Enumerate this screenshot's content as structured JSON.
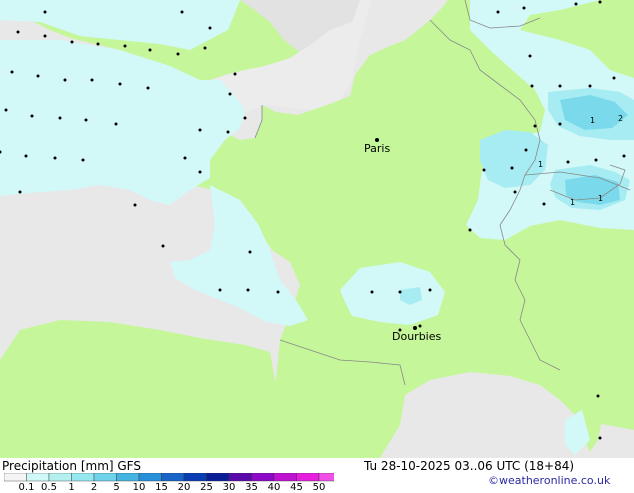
{
  "map": {
    "cities": [
      {
        "name": "Paris"
      },
      {
        "name": "Dourbies"
      }
    ],
    "precip_values": [
      {
        "label": "1"
      },
      {
        "label": "2"
      },
      {
        "label": "1"
      },
      {
        "label": "1"
      },
      {
        "label": "1"
      }
    ]
  },
  "footer": {
    "title": "Precipitation [mm]  GFS",
    "datetime": "Tu 28-10-2025 03..06 UTC (18+84)",
    "copyright": "©weatheronline.co.uk"
  },
  "legend": {
    "ticks": [
      "0.1",
      "0.5",
      "1",
      "2",
      "5",
      "10",
      "15",
      "20",
      "25",
      "30",
      "35",
      "40",
      "45",
      "50"
    ],
    "colors": [
      "#f5f5f5",
      "#d0f8f8",
      "#b4f0f0",
      "#96e8f0",
      "#6ed2ea",
      "#46b4e0",
      "#2890d8",
      "#1864c8",
      "#0a3cb4",
      "#0a1e96",
      "#5a0aaa",
      "#8c0ac8",
      "#be14d2",
      "#e61ede",
      "#f050e6"
    ]
  },
  "colors": {
    "land": "#c5f79a",
    "foreign_land": "#e2e2e2",
    "precip_light": "#d2f8f8",
    "precip_medium": "#a6ecf2",
    "precip_heavy": "#7adaec"
  }
}
